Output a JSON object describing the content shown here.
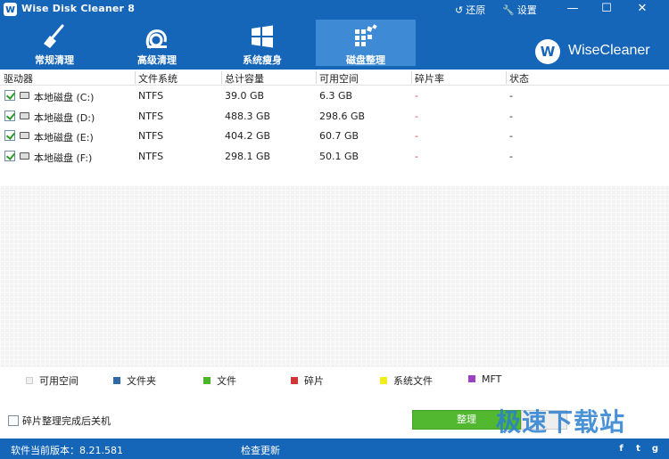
{
  "window": {
    "title": "Wise Disk Cleaner 8",
    "restore_label": "还原",
    "settings_label": "设置"
  },
  "nav": {
    "tabs": [
      {
        "label": "常规清理",
        "icon": "broom-icon"
      },
      {
        "label": "高级清理",
        "icon": "vacuum-icon"
      },
      {
        "label": "系统瘦身",
        "icon": "windows-icon"
      },
      {
        "label": "磁盘整理",
        "icon": "defrag-icon",
        "active": true
      }
    ]
  },
  "brand": {
    "logo_letter": "W",
    "name": "WiseCleaner"
  },
  "table": {
    "headers": [
      "驱动器",
      "文件系统",
      "总计容量",
      "可用空间",
      "碎片率",
      "状态"
    ],
    "rows": [
      {
        "drive": "本地磁盘 (C:)",
        "fs": "NTFS",
        "total": "39.0 GB",
        "free": "6.3 GB",
        "frag": "-",
        "status": "-"
      },
      {
        "drive": "本地磁盘 (D:)",
        "fs": "NTFS",
        "total": "488.3 GB",
        "free": "298.6 GB",
        "frag": "-",
        "status": "-"
      },
      {
        "drive": "本地磁盘 (E:)",
        "fs": "NTFS",
        "total": "404.2 GB",
        "free": "60.7 GB",
        "frag": "-",
        "status": "-"
      },
      {
        "drive": "本地磁盘 (F:)",
        "fs": "NTFS",
        "total": "298.1 GB",
        "free": "50.1 GB",
        "frag": "-",
        "status": "-"
      }
    ]
  },
  "legend": [
    {
      "label": "可用空间",
      "color": "#f0f0f0"
    },
    {
      "label": "文件夹",
      "color": "#2e6aa8"
    },
    {
      "label": "文件",
      "color": "#49b52c"
    },
    {
      "label": "碎片",
      "color": "#d13535"
    },
    {
      "label": "系统文件",
      "color": "#f2ec1c"
    },
    {
      "label": "MFT",
      "color": "#9d3fc2"
    }
  ],
  "controls": {
    "shutdown_label": "碎片整理完成后关机",
    "defrag_label": "整理"
  },
  "watermark": "极速下载站",
  "status": {
    "version": "软件当前版本：8.21.581",
    "check_update": "检查更新"
  },
  "social": [
    "f",
    "t",
    "g"
  ],
  "colors": {
    "primary": "#1565b8",
    "active_tab": "#3e8ad4",
    "accent_green": "#52b830",
    "fragment_red": "#e23b3b"
  }
}
